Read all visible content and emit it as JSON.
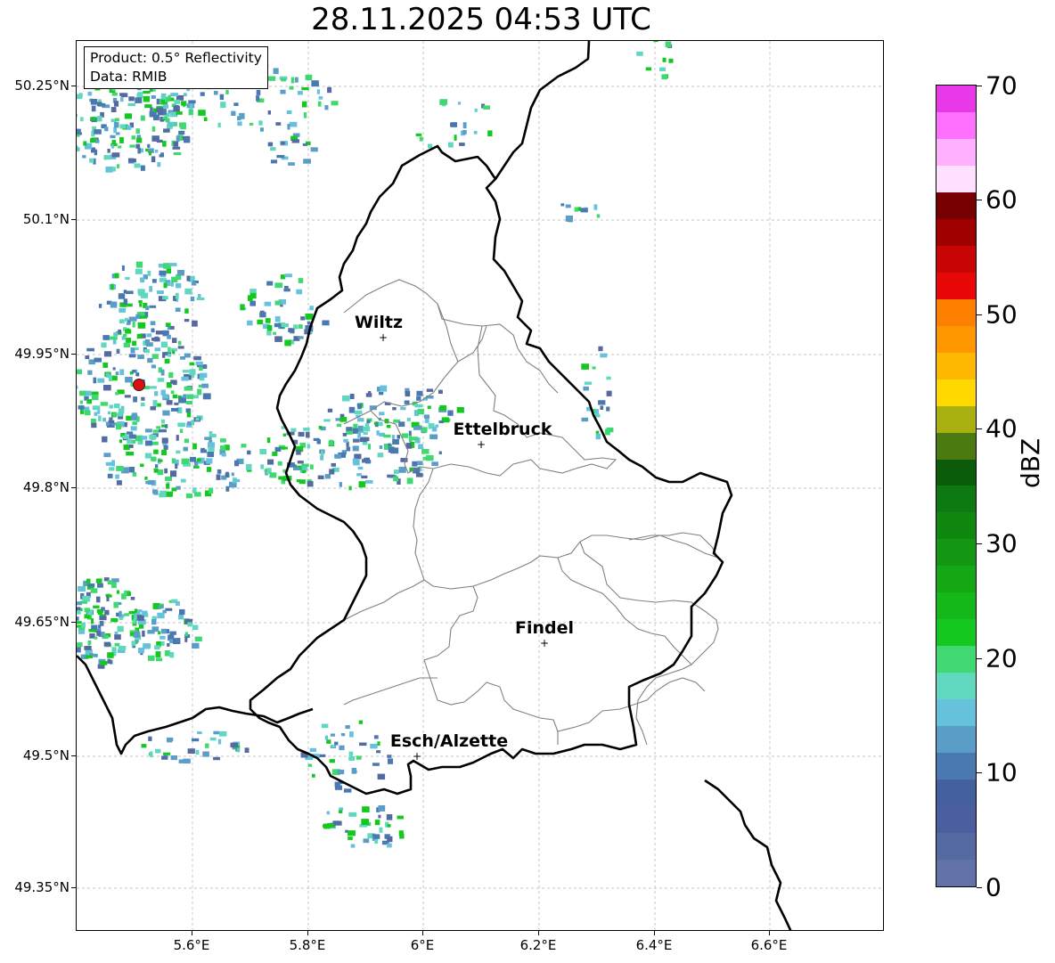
{
  "title": "28.11.2025 04:53 UTC",
  "info_box": {
    "line1": "Product: 0.5° Reflectivity",
    "line2": "Data: RMIB"
  },
  "latitude_ticks": [
    "50.25°N",
    "50.1°N",
    "49.95°N",
    "49.8°N",
    "49.65°N",
    "49.5°N",
    "49.35°N"
  ],
  "longitude_ticks": [
    "5.6°E",
    "5.8°E",
    "6°E",
    "6.2°E",
    "6.4°E",
    "6.6°E"
  ],
  "cities": [
    {
      "name": "Wiltz"
    },
    {
      "name": "Ettelbruck"
    },
    {
      "name": "Findel"
    },
    {
      "name": "Esch/Alzette"
    }
  ],
  "colorbar": {
    "label": "dBZ",
    "tick_labels": [
      "0",
      "10",
      "20",
      "30",
      "40",
      "50",
      "60",
      "70"
    ],
    "colors": [
      "#6272a8",
      "#566aa2",
      "#4a5ea0",
      "#44609e",
      "#4a78b0",
      "#5a9ec8",
      "#66c2dc",
      "#60d8c0",
      "#40d870",
      "#14c820",
      "#14b818",
      "#14a814",
      "#149814",
      "#108810",
      "#0c7a10",
      "#0a5c0a",
      "#4a7a10",
      "#a8b010",
      "#ffd800",
      "#ffb800",
      "#ff9800",
      "#ff8000",
      "#e80808",
      "#c80404",
      "#a00000",
      "#780000",
      "#ffe0ff",
      "#ffb0ff",
      "#ff70ff",
      "#e838e8"
    ]
  },
  "colors": {
    "border": "#000000",
    "canton_border": "#808080",
    "grid": "#b0b0b0",
    "radar_site": "#e01010"
  }
}
